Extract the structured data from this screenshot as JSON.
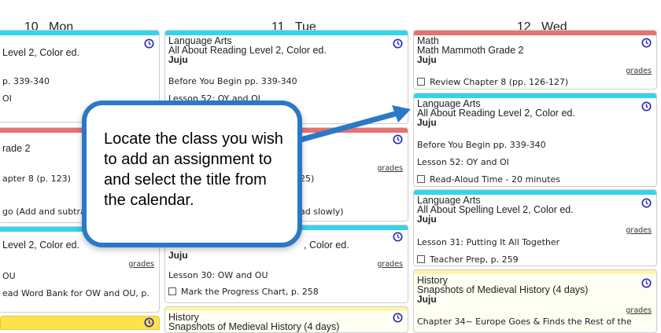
{
  "days": [
    {
      "num": "10",
      "name": "Mon"
    },
    {
      "num": "11",
      "name": "Tue"
    },
    {
      "num": "12",
      "name": "Wed"
    }
  ],
  "colors": {
    "language_arts": "#34d4ec",
    "math": "#e87070",
    "history": "#fff5a6",
    "history_solid": "#fde24c",
    "clock": "#2a2ab8",
    "callout_border": "#2b78c8",
    "arrow": "#2b78c8"
  },
  "icons": {
    "schedule": "clock-icon",
    "task": "checkbox-icon"
  },
  "grades_label": "grades",
  "mon": {
    "card1": {
      "course": "Level 2, Color ed.",
      "l1": "p. 339-340",
      "l2": "OI"
    },
    "card2": {
      "course": "rade 2",
      "l1": "apter 8 (p. 123)",
      "l2": "go (Add and subtrac"
    },
    "card3": {
      "course": "Level 2, Color ed.",
      "l1": "OU",
      "l2": "ead Word Bank for OW and OU, p."
    }
  },
  "tue": {
    "card1": {
      "subject": "Language Arts",
      "course": "All About Reading Level 2, Color ed.",
      "student": "Juju",
      "l1": "Before You Begin pp. 339-340",
      "l2": "Lesson 52: OY and OI"
    },
    "card2": {
      "l1": "25)",
      "l2": "ad slowly)"
    },
    "card3": {
      "course": ", Color ed.",
      "student": "Juju",
      "l1": "Lesson 30: OW and OU",
      "task": "Mark the Progress Chart, p. 258"
    },
    "card4": {
      "subject": "History",
      "course": "Snapshots of Medieval History (4 days)"
    }
  },
  "wed": {
    "card1": {
      "subject": "Math",
      "course": "Math Mammoth Grade 2",
      "student": "Juju",
      "task": "Review Chapter 8 (pp. 126-127)"
    },
    "card2": {
      "subject": "Language Arts",
      "course": "All About Reading Level 2, Color ed.",
      "student": "Juju",
      "l1": "Before You Begin pp. 339-340",
      "l2": "Lesson 52: OY and OI",
      "task": "Read-Aloud Time - 20 minutes"
    },
    "card3": {
      "subject": "Language Arts",
      "course": "All About Spelling Level 2, Color ed.",
      "student": "Juju",
      "l1": "Lesson 31: Putting It All Together",
      "task": "Teacher Prep, p. 259"
    },
    "card4": {
      "subject": "History",
      "course": "Snapshots of Medieval History (4 days)",
      "student": "Juju",
      "l1": "Chapter 34~ Europe Goes & Finds the Rest of the"
    }
  },
  "callout": {
    "text": "Locate the class you wish to add an assignment to and select the title from the calendar."
  }
}
